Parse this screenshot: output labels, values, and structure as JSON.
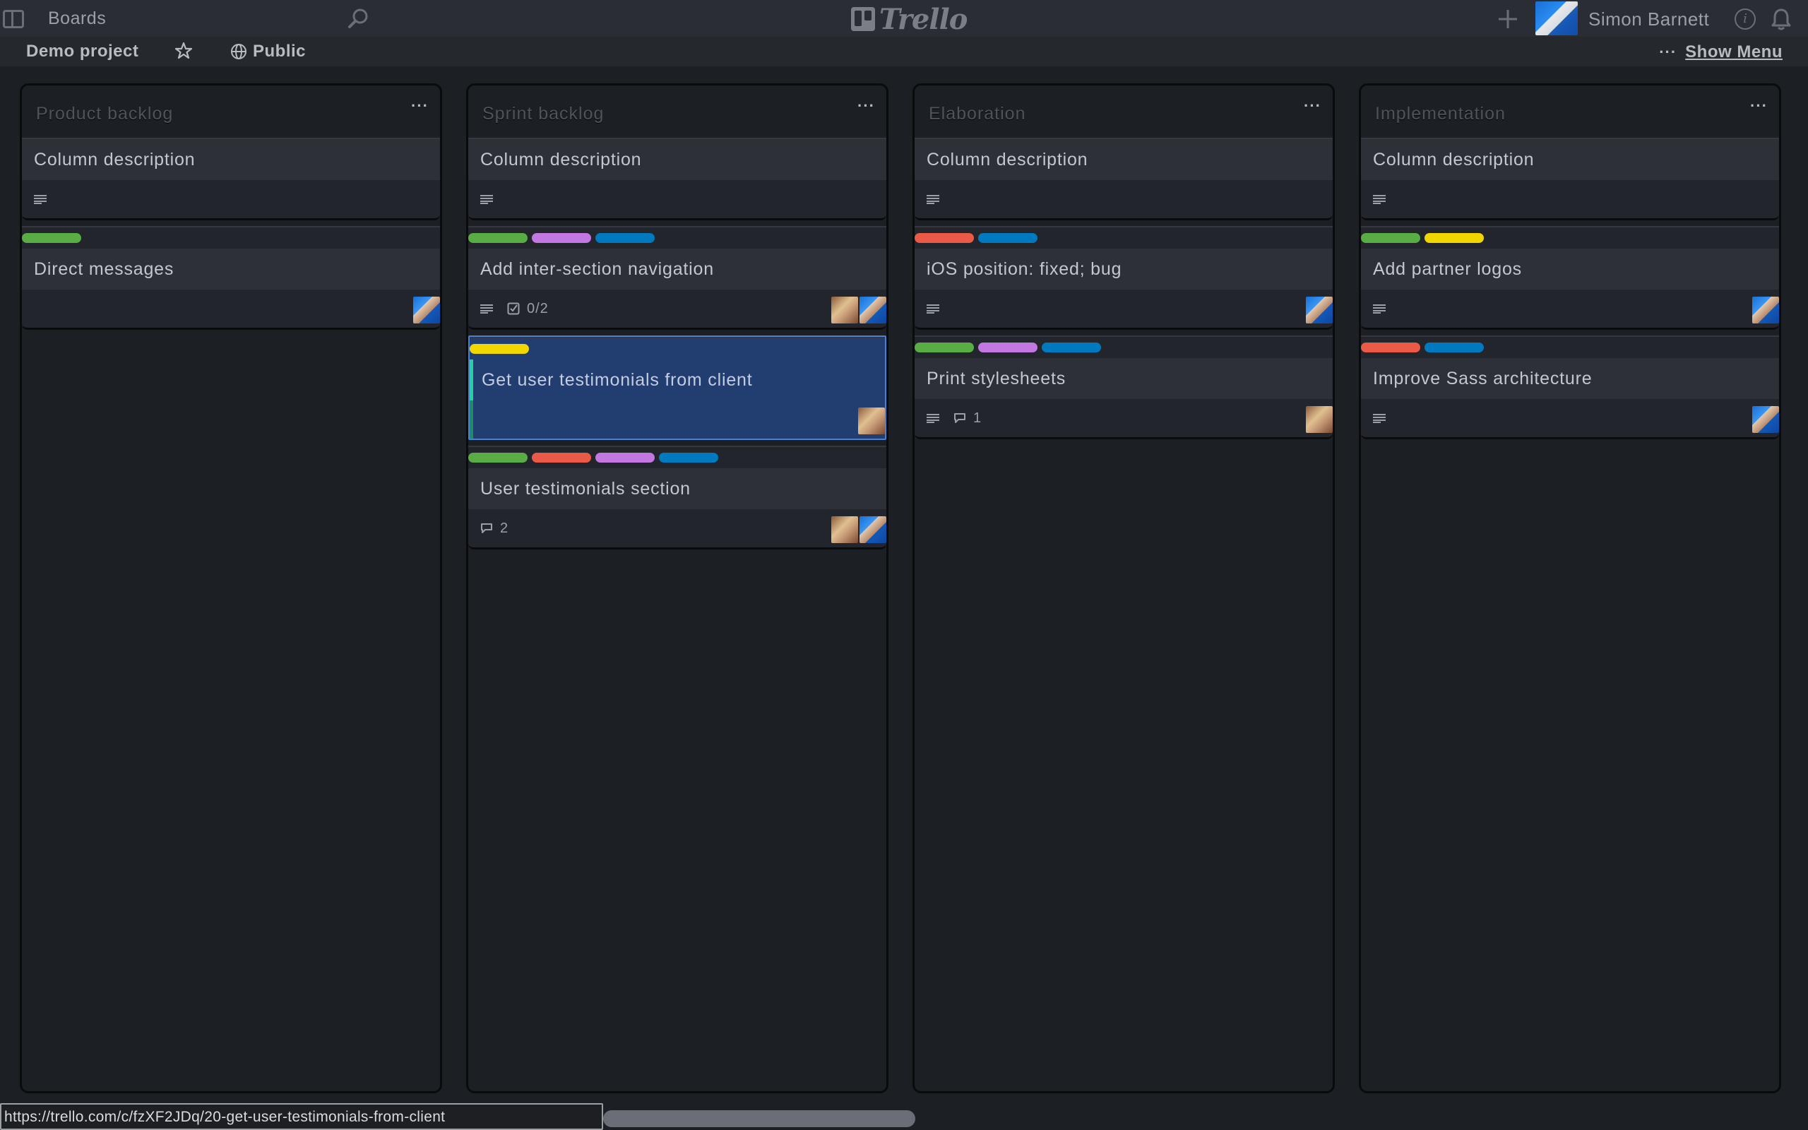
{
  "header": {
    "boards_label": "Boards",
    "logo_text": "Trello",
    "user_name": "Simon Barnett",
    "info_glyph": "i"
  },
  "board": {
    "title": "Demo project",
    "visibility": "Public",
    "menu_dots": "···",
    "show_menu": "Show Menu"
  },
  "label_colors": {
    "green": "#5aac44",
    "purple": "#c377e0",
    "blue": "#0079bf",
    "red": "#eb5a46",
    "yellow": "#f2d600"
  },
  "lists": [
    {
      "title": "Product backlog",
      "menu": "···",
      "cards": [
        {
          "title": "Column description",
          "labels": [],
          "desc": true,
          "checklist": "",
          "comments": "",
          "members": []
        },
        {
          "title": "Direct messages",
          "labels": [
            "green"
          ],
          "desc": false,
          "checklist": "",
          "comments": "",
          "members": [
            "simon"
          ]
        }
      ]
    },
    {
      "title": "Sprint backlog",
      "menu": "···",
      "cards": [
        {
          "title": "Column description",
          "labels": [],
          "desc": true,
          "checklist": "",
          "comments": "",
          "members": []
        },
        {
          "title": "Add inter-section navigation",
          "labels": [
            "green",
            "purple",
            "blue"
          ],
          "desc": true,
          "checklist": "0/2",
          "comments": "",
          "members": [
            "other",
            "simon"
          ]
        },
        {
          "title": "Get user testimonials from client",
          "labels": [
            "yellow"
          ],
          "desc": false,
          "checklist": "",
          "comments": "",
          "members": [
            "other"
          ],
          "selected": true
        },
        {
          "title": "User testimonials section",
          "labels": [
            "green",
            "red",
            "purple",
            "blue"
          ],
          "desc": false,
          "checklist": "",
          "comments": "2",
          "members": [
            "other",
            "simon"
          ]
        }
      ]
    },
    {
      "title": "Elaboration",
      "menu": "···",
      "cards": [
        {
          "title": "Column description",
          "labels": [],
          "desc": true,
          "checklist": "",
          "comments": "",
          "members": []
        },
        {
          "title": "iOS position: fixed; bug",
          "labels": [
            "red",
            "blue"
          ],
          "desc": true,
          "checklist": "",
          "comments": "",
          "members": [
            "simon"
          ]
        },
        {
          "title": "Print stylesheets",
          "labels": [
            "green",
            "purple",
            "blue"
          ],
          "desc": true,
          "checklist": "",
          "comments": "1",
          "members": [
            "other"
          ]
        }
      ]
    },
    {
      "title": "Implementation",
      "menu": "···",
      "cards": [
        {
          "title": "Column description",
          "labels": [],
          "desc": true,
          "checklist": "",
          "comments": "",
          "members": []
        },
        {
          "title": "Add partner logos",
          "labels": [
            "green",
            "yellow"
          ],
          "desc": true,
          "checklist": "",
          "comments": "",
          "members": [
            "simon"
          ]
        },
        {
          "title": "Improve Sass architecture",
          "labels": [
            "red",
            "blue"
          ],
          "desc": true,
          "checklist": "",
          "comments": "",
          "members": [
            "simon"
          ]
        }
      ]
    }
  ],
  "status_bar": {
    "url": "https://trello.com/c/fzXF2JDq/20-get-user-testimonials-from-client"
  }
}
